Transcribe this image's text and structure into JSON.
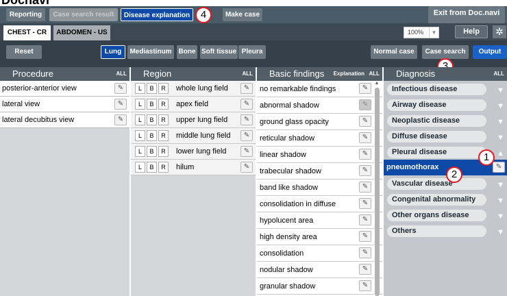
{
  "app": {
    "title": "Docnavi"
  },
  "topbar": {
    "reporting": "Reporting",
    "case_search_result": "Case search result",
    "disease_explanation": "Disease explanation",
    "make_case": "Make case",
    "exit": "Exit from Doc.navi"
  },
  "tabs": {
    "chest": "CHEST - CR",
    "abdomen": "ABDOMEN - US"
  },
  "toolbar": {
    "zoom": "100%",
    "help": "Help"
  },
  "filters": {
    "reset": "Reset",
    "lung": "Lung",
    "mediastinum": "Mediastinum",
    "bone": "Bone",
    "soft_tissue": "Soft tissue",
    "pleura": "Pleura",
    "normal_case": "Normal case",
    "case_search": "Case search",
    "output": "Output"
  },
  "columns": {
    "procedure": {
      "title": "Procedure",
      "all": "ALL",
      "items": [
        "posterior-anterior view",
        "lateral view",
        "lateral decubitus view"
      ]
    },
    "region": {
      "title": "Region",
      "all": "ALL",
      "side_l": "L",
      "side_b": "B",
      "side_r": "R",
      "items": [
        "whole lung field",
        "apex field",
        "upper lung field",
        "middle lung field",
        "lower lung field",
        "hilum"
      ]
    },
    "basic": {
      "title": "Basic findings",
      "explanation": "Explanation",
      "all": "ALL",
      "items": [
        "no remarkable findings",
        "abnormal shadow",
        "ground glass opacity",
        "reticular shadow",
        "linear shadow",
        "trabecular shadow",
        "band like shadow",
        "consolidation in diffuse",
        "hypolucent area",
        "high density area",
        "consolidation",
        "nodular shadow",
        "granular shadow"
      ]
    },
    "diagnosis": {
      "title": "Diagnosis",
      "all": "ALL",
      "items": [
        "Infectious disease",
        "Airway disease",
        "Neoplastic disease",
        "Diffuse disease",
        "Pleural disease",
        "pneumothorax",
        "Vascular disease",
        "Congenital abnormality",
        "Other organs disease",
        "Others"
      ]
    }
  },
  "markers": {
    "m1": "1",
    "m2": "2",
    "m3": "3",
    "m4": "4"
  }
}
